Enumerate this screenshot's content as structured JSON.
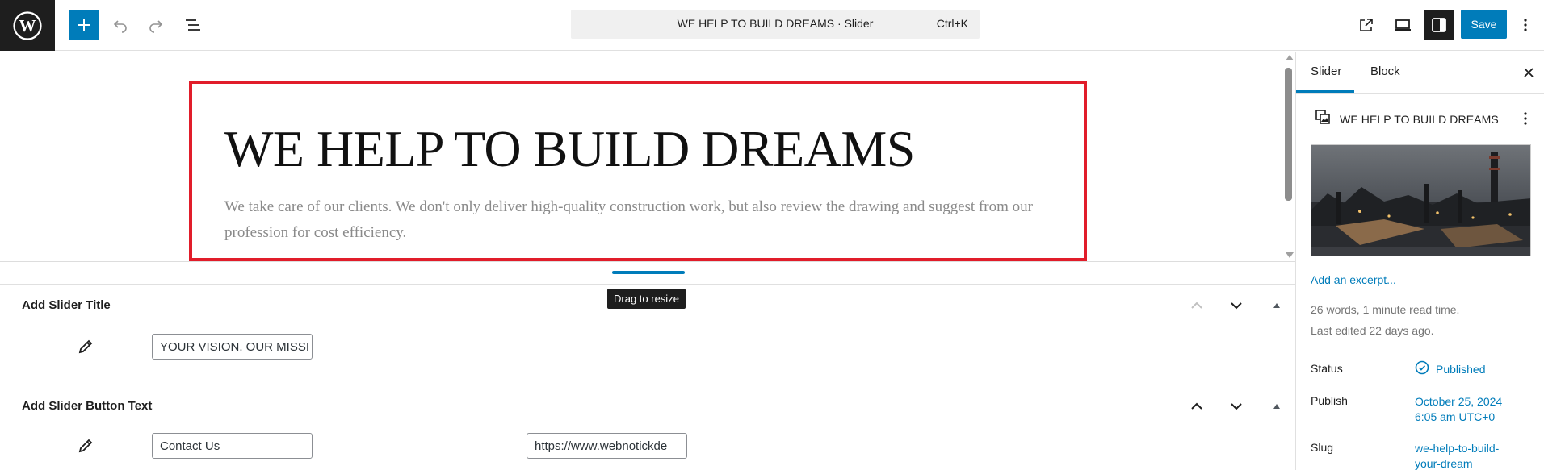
{
  "topbar": {
    "command_title": "WE HELP TO BUILD DREAMS · Slider",
    "command_shortcut": "Ctrl+K",
    "save_label": "Save"
  },
  "canvas": {
    "slide_title": "WE HELP TO BUILD DREAMS",
    "slide_description": "We take care of our clients. We don't only deliver high-quality construction work, but also review the drawing and suggest from our profession for cost efficiency."
  },
  "resize": {
    "tooltip": "Drag to resize"
  },
  "metaboxes": {
    "slider_title": {
      "heading": "Add Slider Title",
      "field_value": "YOUR VISION. OUR MISSI"
    },
    "slider_button": {
      "heading": "Add Slider Button Text",
      "text_value": "Contact Us",
      "url_value": "https://www.webnotickde"
    }
  },
  "sidebar": {
    "tabs": [
      "Slider",
      "Block"
    ],
    "post_title": "WE HELP TO BUILD DREAMS",
    "excerpt_link": "Add an excerpt...",
    "word_count": "26 words, 1 minute read time.",
    "last_edited": "Last edited 22 days ago.",
    "status_label": "Status",
    "status_value": "Published",
    "publish_label": "Publish",
    "publish_date": "October 25, 2024",
    "publish_time": "6:05 am UTC+0",
    "slug_label": "Slug",
    "slug_line1": "we-help-to-build-",
    "slug_line2": "your-dream"
  },
  "colors": {
    "accent": "#007cba",
    "slide_border": "#e11d2a",
    "dark": "#1e1e1e"
  },
  "icons": [
    "wordpress-logo-icon",
    "plus-icon",
    "undo-icon",
    "redo-icon",
    "list-view-icon",
    "external-link-icon",
    "desktop-icon",
    "sidebar-toggle-icon",
    "kebab-menu-icon",
    "pencil-icon",
    "chevron-up-icon",
    "chevron-down-icon",
    "triangle-up-icon",
    "close-icon",
    "post-type-icon",
    "check-circle-icon"
  ]
}
